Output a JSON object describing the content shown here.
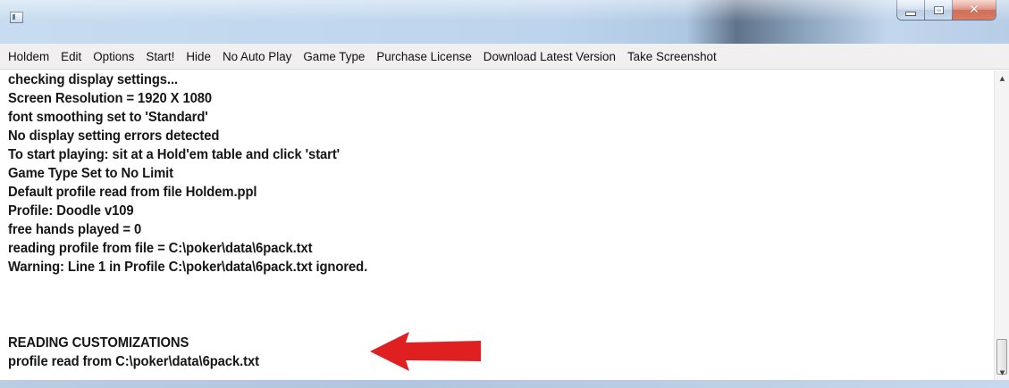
{
  "window": {
    "title": "",
    "icons": {
      "app": "app-icon",
      "minimize": "minimize-icon",
      "maximize": "maximize-icon",
      "close": "close-icon"
    }
  },
  "menu": {
    "items": [
      "Holdem",
      "Edit",
      "Options",
      "Start!",
      "Hide",
      "No Auto Play",
      "Game Type",
      "Purchase License",
      "Download Latest Version",
      "Take Screenshot"
    ]
  },
  "log": {
    "lines": [
      "checking display settings...",
      "Screen Resolution = 1920 X 1080",
      "font smoothing set to 'Standard'",
      "No display setting errors detected",
      "To start playing: sit at a Hold'em table and click 'start'",
      "Game Type Set to No Limit",
      "Default profile read from file Holdem.ppl",
      "Profile: Doodle v109",
      "free hands played = 0",
      "reading profile from file = C:\\poker\\data\\6pack.txt",
      "Warning: Line 1 in Profile C:\\poker\\data\\6pack.txt ignored.",
      "",
      "READING CUSTOMIZATIONS",
      "profile read from C:\\poker\\data\\6pack.txt"
    ]
  },
  "annotation": {
    "arrow_color": "#e02020",
    "icon": "left-arrow-icon"
  },
  "scrollbar": {
    "up_icon": "scroll-up-icon",
    "down_icon": "scroll-down-icon"
  }
}
